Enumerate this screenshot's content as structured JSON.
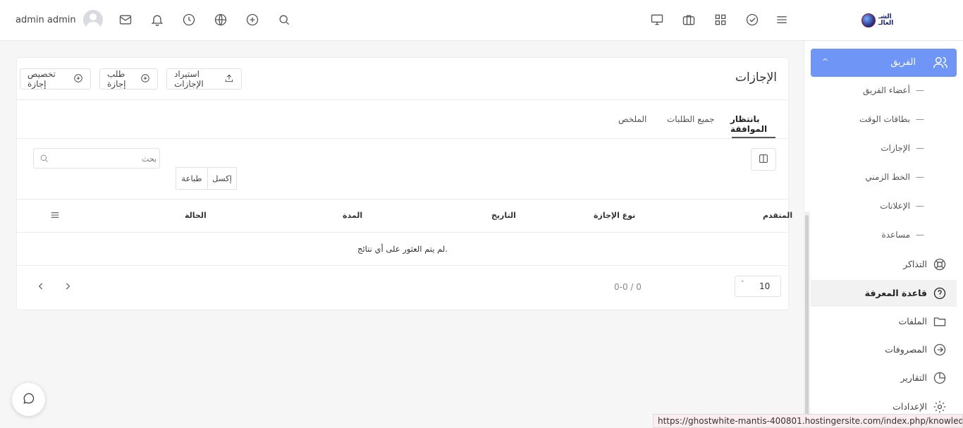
{
  "topbar": {
    "user_name": "admin admin",
    "logo_text_line1": "الشـ",
    "logo_text_line2": "العالـ"
  },
  "sidebar": {
    "team_label": "الفريق",
    "team_chevron": "^",
    "sub_items": [
      "أعضاء الفريق",
      "بطاقات الوقت",
      "الإجازات",
      "الخط الزمني",
      "الإعلانات",
      "مساعدة"
    ],
    "sub_dash": "—",
    "items": [
      {
        "label": "التذاكر",
        "icon": "lifebuoy-icon"
      },
      {
        "label": "قاعدة المعرفة",
        "icon": "help-circle-icon",
        "active": true
      },
      {
        "label": "الملفات",
        "icon": "folder-icon"
      },
      {
        "label": "المصروفات",
        "icon": "arrow-circle-icon"
      },
      {
        "label": "التقارير",
        "icon": "pie-chart-icon"
      },
      {
        "label": "الإعدادات",
        "icon": "gear-icon"
      }
    ]
  },
  "main": {
    "title": "الإجازات",
    "buttons": {
      "import": "استيراد الإجازات",
      "request": "طلب إجازة",
      "assign": "تخصيص إجازة"
    },
    "tabs": [
      "بانتظار الموافقة",
      "جميع الطلبات",
      "الملخص"
    ],
    "search_placeholder": "بحث",
    "export": {
      "excel": "إكسل",
      "print": "طباعة"
    },
    "columns": [
      "المتقدم",
      "نوع الإجازة",
      "التاريخ",
      "المدة",
      "الحالة"
    ],
    "empty_message": "لم يتم العثور على أي نتائج.",
    "pagination": {
      "summary": "0-0 / 0",
      "page_size": "10",
      "page_size_chevron": "˅"
    }
  },
  "status_url": "https://ghostwhite-mantis-400801.hostingersite.com/index.php/knowledge_base"
}
